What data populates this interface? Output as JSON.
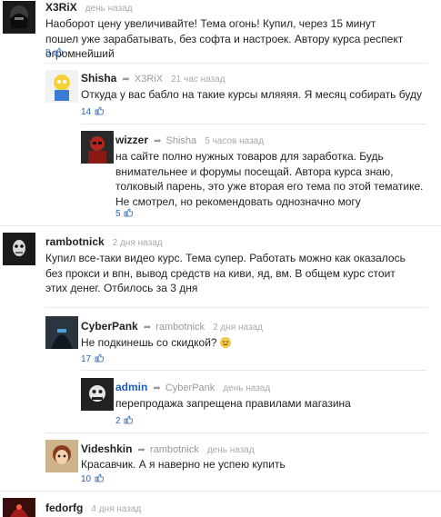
{
  "comments": [
    {
      "author": "X3RiX",
      "reply_to": "",
      "time": "день назад",
      "text": "Наоборот цену увеличивайте! Тема огонь! Купил, через 15 минут пошел уже зарабатывать, без софта и настроек. Автору курса респект огромнейший",
      "likes": "8"
    },
    {
      "author": "Shisha",
      "reply_to": "X3RiX",
      "time": "21 час назад",
      "text": "Откуда у вас бабло на такие курсы мляяяя. Я месяц собирать буду",
      "likes": "14"
    },
    {
      "author": "wizzer",
      "reply_to": "Shisha",
      "time": "5 часов назад",
      "text": "на сайте полно нужных товаров для заработка. Будь внимательнее и форумы посещай. Автора курса знаю, толковый парень, это уже вторая его тема по этой тематике. Не смотрел, но рекомендовать однозначно могу",
      "likes": "5"
    },
    {
      "author": "rambotnick",
      "reply_to": "",
      "time": "2 дня назад",
      "text": "Купил все-таки видео курс. Тема супер. Работать можно как оказалось без прокси и впн, вывод средств на киви, яд, вм. В общем курс стоит этих денег. Отбилось за 3 дня",
      "likes": ""
    },
    {
      "author": "CyberPank",
      "reply_to": "rambotnick",
      "time": "2 дня назад",
      "text": "Не подкинешь со скидкой?",
      "likes": "17"
    },
    {
      "author": "admin",
      "reply_to": "CyberPank",
      "time": "день назад",
      "text": "перепродажа запрещена правилами магазина",
      "likes": "2"
    },
    {
      "author": "Videshkin",
      "reply_to": "rambotnick",
      "time": "день назад",
      "text": "Красавчик. А я наверно не успею купить",
      "likes": "10"
    },
    {
      "author": "fedorfg",
      "reply_to": "",
      "time": "4 дня назад",
      "text": "",
      "likes": ""
    }
  ],
  "icons": {
    "reply": "reply-arrow-icon",
    "like": "thumbs-up-icon",
    "emoji": "smile-emoji-icon"
  },
  "colors": {
    "author": "#222222",
    "admin_author": "#1a5fb4",
    "meta": "#aaaaaa",
    "likes": "#2a64b0"
  }
}
